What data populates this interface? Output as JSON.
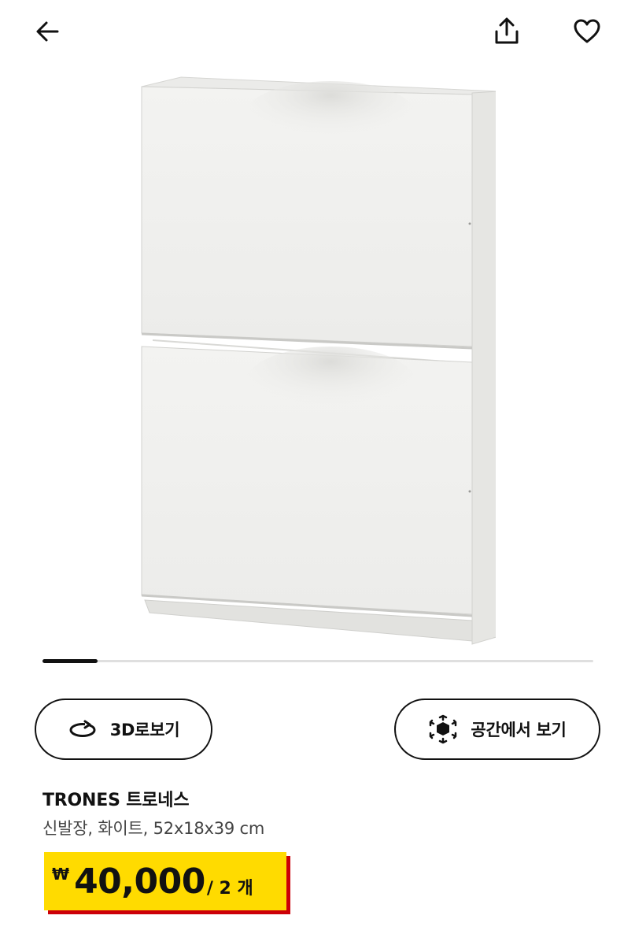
{
  "header": {
    "icons": {
      "back": "arrow-left-icon",
      "share": "share-upload-icon",
      "favorite": "heart-outline-icon"
    }
  },
  "gallery": {
    "image_alt": "TRONES 트로네스 신발장, 화이트",
    "carousel_progress": 0.1
  },
  "actions": {
    "view_3d_label": "3D로보기",
    "view_3d_icon": "rotate-360-icon",
    "view_in_space_label": "공간에서 보기",
    "view_in_space_icon": "ar-cube-icon"
  },
  "product": {
    "name": "TRONES 트로네스",
    "description": "신발장, 화이트, 52x18x39 cm",
    "price": {
      "currency": "₩",
      "amount": "40,000",
      "unit": "/ 2 개",
      "tag_color": "#ffdb00",
      "shadow_color": "#cc0008"
    }
  }
}
